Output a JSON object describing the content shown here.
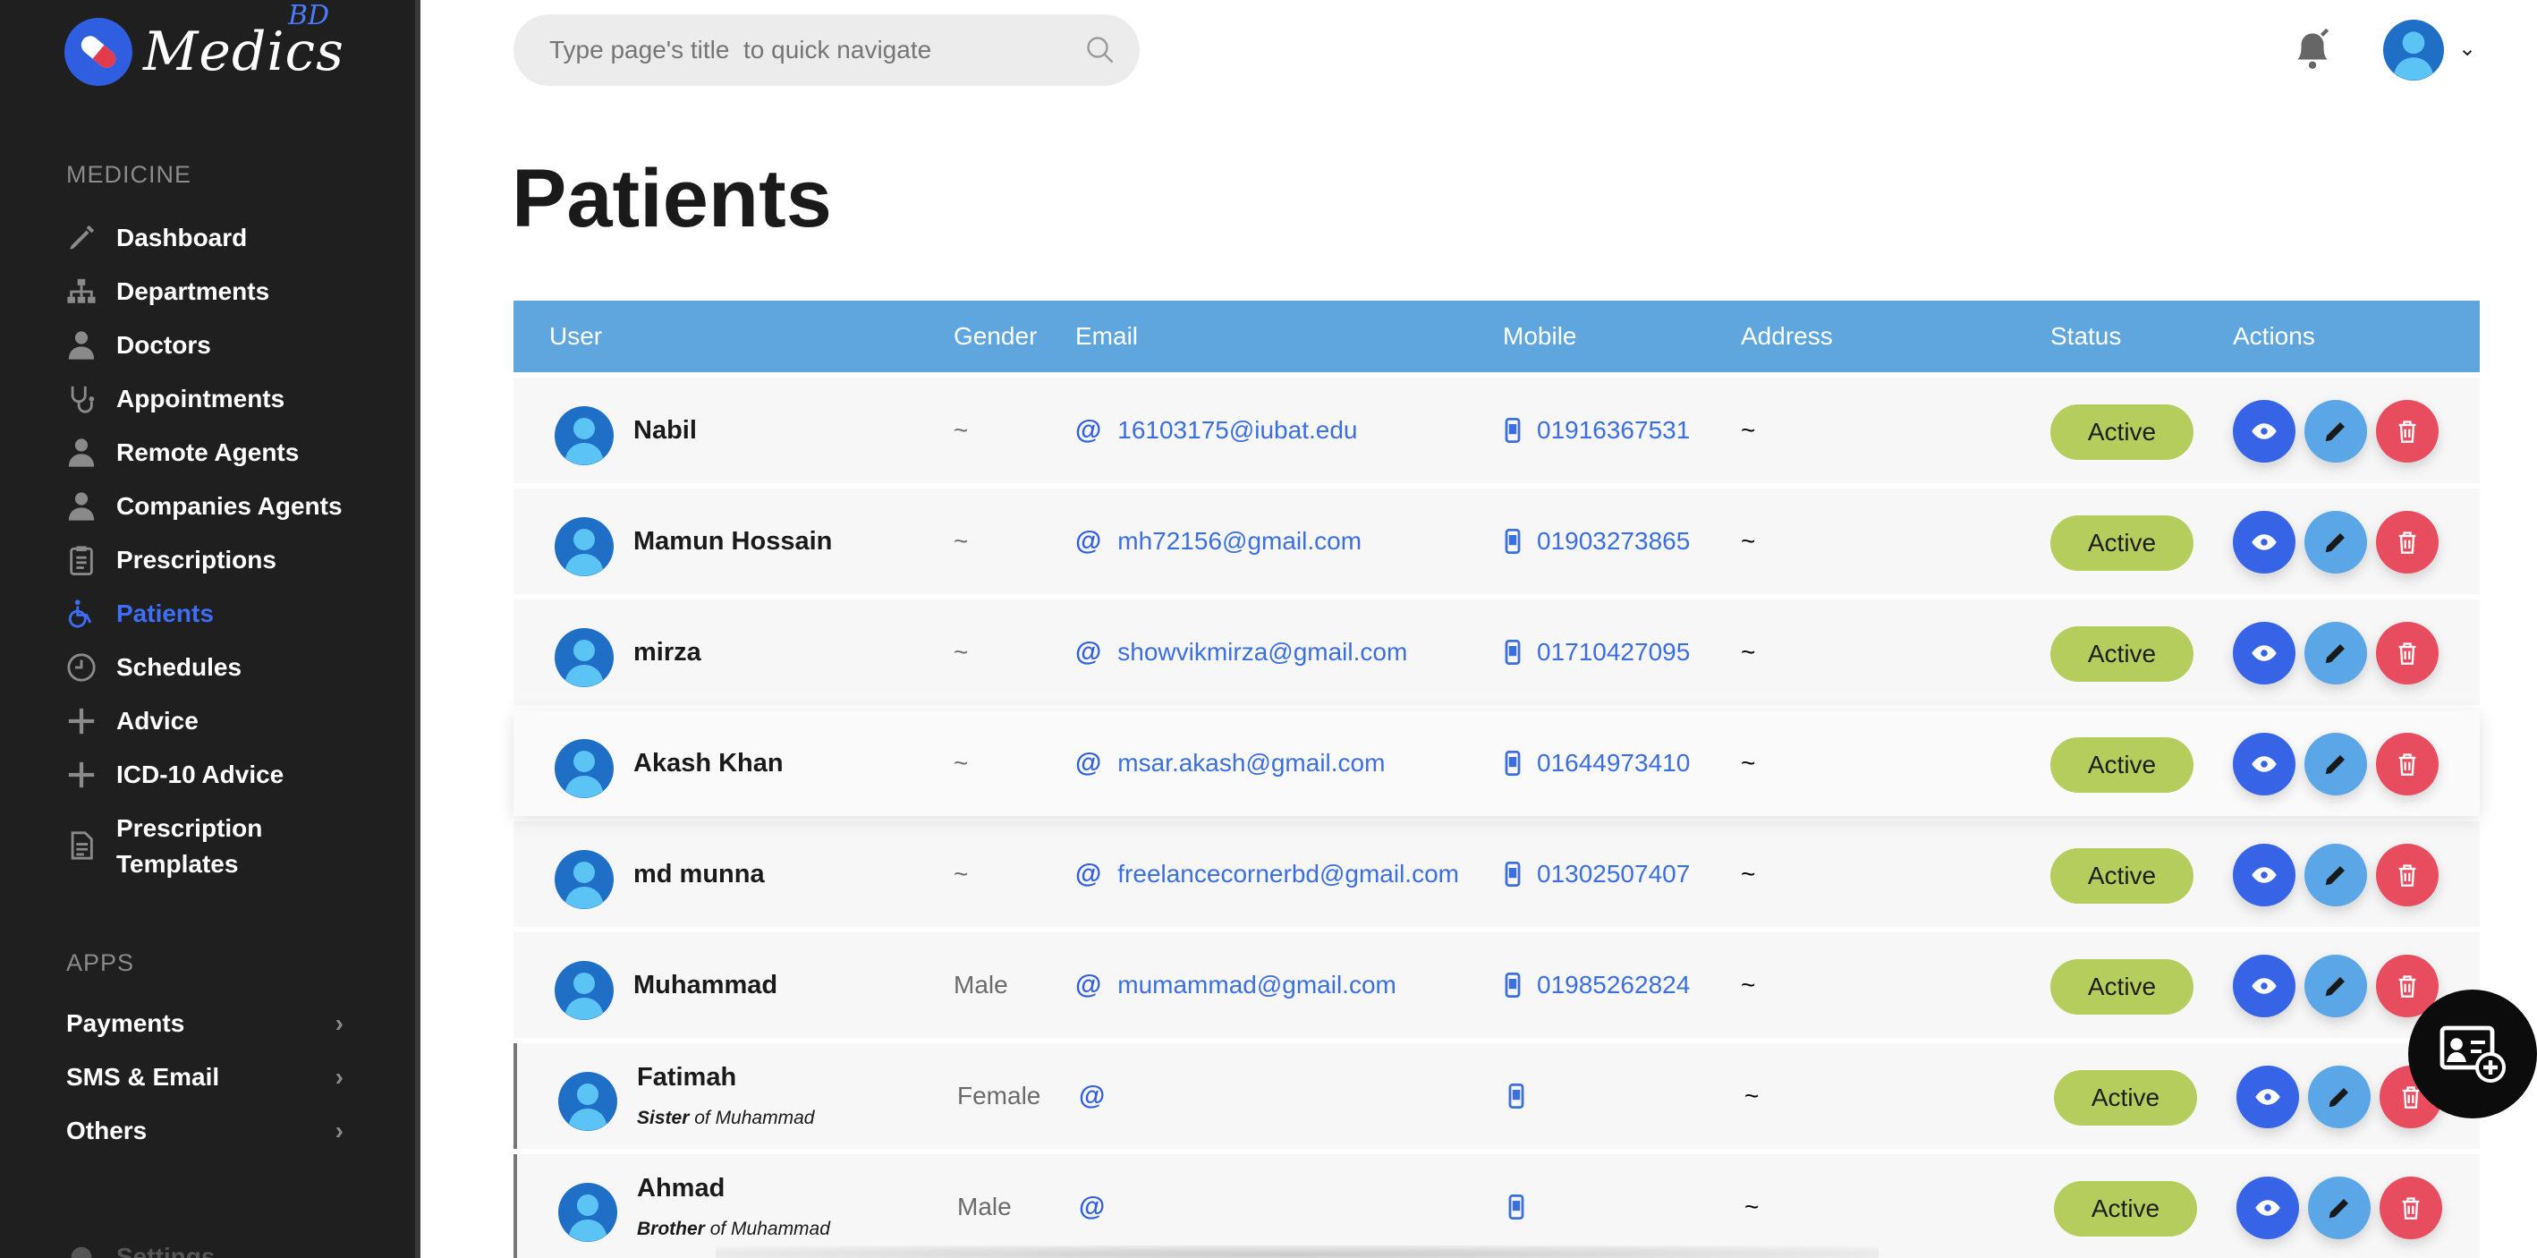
{
  "brand": {
    "name": "Medics",
    "sup": "BD"
  },
  "sidebar": {
    "section_medicine": "MEDICINE",
    "items": [
      {
        "label": "Dashboard",
        "icon": "pen-icon"
      },
      {
        "label": "Departments",
        "icon": "hierarchy-icon"
      },
      {
        "label": "Doctors",
        "icon": "doctor-icon"
      },
      {
        "label": "Appointments",
        "icon": "stethoscope-icon"
      },
      {
        "label": "Remote Agents",
        "icon": "agent-icon"
      },
      {
        "label": "Companies Agents",
        "icon": "agent-icon"
      },
      {
        "label": "Prescriptions",
        "icon": "clipboard-icon"
      },
      {
        "label": "Patients",
        "icon": "wheelchair-icon",
        "active": true
      },
      {
        "label": "Schedules",
        "icon": "clock-icon"
      },
      {
        "label": "Advice",
        "icon": "plus-icon"
      },
      {
        "label": "ICD-10 Advice",
        "icon": "plus-icon"
      },
      {
        "label": "Prescription Templates",
        "icon": "document-icon"
      }
    ],
    "section_apps": "APPS",
    "apps": [
      {
        "label": "Payments"
      },
      {
        "label": "SMS & Email"
      },
      {
        "label": "Others"
      }
    ],
    "settings_label": "Settings"
  },
  "search": {
    "placeholder": "Type page's title  to quick navigate"
  },
  "page": {
    "title": "Patients"
  },
  "table": {
    "headers": {
      "user": "User",
      "gender": "Gender",
      "email": "Email",
      "mobile": "Mobile",
      "address": "Address",
      "status": "Status",
      "actions": "Actions"
    },
    "rows": [
      {
        "name": "Nabil",
        "relation": "",
        "relation_of": "",
        "gender": "~",
        "email": "16103175@iubat.edu",
        "mobile": "01916367531",
        "address": "~",
        "status": "Active"
      },
      {
        "name": "Mamun Hossain",
        "relation": "",
        "relation_of": "",
        "gender": "~",
        "email": "mh72156@gmail.com",
        "mobile": "01903273865",
        "address": "~",
        "status": "Active"
      },
      {
        "name": "mirza",
        "relation": "",
        "relation_of": "",
        "gender": "~",
        "email": "showvikmirza@gmail.com",
        "mobile": "01710427095",
        "address": "~",
        "status": "Active"
      },
      {
        "name": "Akash Khan",
        "relation": "",
        "relation_of": "",
        "gender": "~",
        "email": "msar.akash@gmail.com",
        "mobile": "01644973410",
        "address": "~",
        "status": "Active"
      },
      {
        "name": "md munna",
        "relation": "",
        "relation_of": "",
        "gender": "~",
        "email": "freelancecornerbd@gmail.com",
        "mobile": "01302507407",
        "address": "~",
        "status": "Active"
      },
      {
        "name": "Muhammad",
        "relation": "",
        "relation_of": "",
        "gender": "Male",
        "email": "mumammad@gmail.com",
        "mobile": "01985262824",
        "address": "~",
        "status": "Active"
      },
      {
        "name": "Fatimah",
        "relation": "Sister",
        "relation_of": "of Muhammad",
        "gender": "Female",
        "email": "",
        "mobile": "",
        "address": "~",
        "status": "Active"
      },
      {
        "name": "Ahmad",
        "relation": "Brother",
        "relation_of": "of Muhammad",
        "gender": "Male",
        "email": "",
        "mobile": "",
        "address": "~",
        "status": "Active"
      }
    ]
  },
  "colors": {
    "accent": "#3d6ef5",
    "header": "#5fa6df",
    "status": "#b5cd5c",
    "view": "#3763e6",
    "edit": "#5ba6e6",
    "delete": "#e74c5f"
  }
}
